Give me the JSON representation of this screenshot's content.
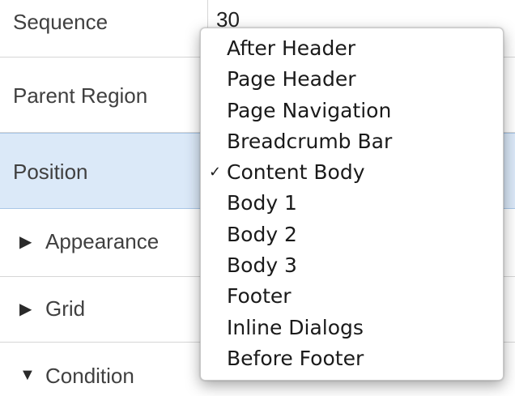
{
  "properties": {
    "sequence": {
      "label": "Sequence",
      "value": "30"
    },
    "parent_region": {
      "label": "Parent Region"
    },
    "position": {
      "label": "Position"
    }
  },
  "sections": {
    "appearance": {
      "label": "Appearance",
      "arrow": "▶",
      "state": "collapsed"
    },
    "grid": {
      "label": "Grid",
      "arrow": "▶",
      "state": "collapsed"
    },
    "condition": {
      "label": "Condition",
      "arrow": "▼",
      "state": "expanded"
    }
  },
  "dropdown": {
    "check_glyph": "✓",
    "selected": "Content Body",
    "items": [
      {
        "label": "After Header"
      },
      {
        "label": "Page Header"
      },
      {
        "label": "Page Navigation"
      },
      {
        "label": "Breadcrumb Bar"
      },
      {
        "label": "Content Body"
      },
      {
        "label": "Body 1"
      },
      {
        "label": "Body 2"
      },
      {
        "label": "Body 3"
      },
      {
        "label": "Footer"
      },
      {
        "label": "Inline Dialogs"
      },
      {
        "label": "Before Footer"
      }
    ]
  },
  "icons": {
    "select_arrows": "select-updown-icon",
    "collapsed": "triangle-right-icon",
    "expanded": "triangle-down-icon"
  },
  "colors": {
    "selected_row_bg": "#dbe9f8",
    "row_divider": "#d6d6d6"
  }
}
